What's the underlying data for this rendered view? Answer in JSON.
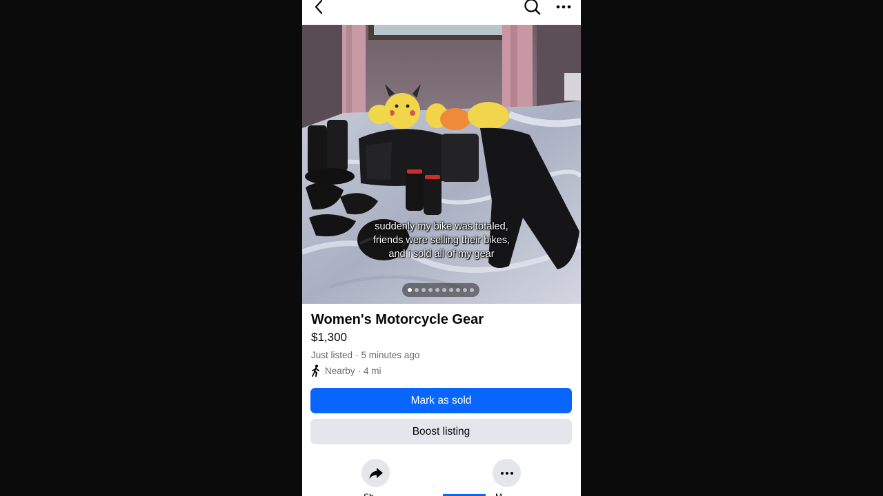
{
  "listing": {
    "title": "Women's Motorcycle Gear",
    "price": "$1,300",
    "listed": "Just listed",
    "time_ago": "5 minutes ago",
    "location": "Nearby",
    "distance": "4 mi"
  },
  "photo": {
    "caption": "suddenly my bike was totaled, friends were selling their bikes, and i sold all of my gear",
    "total_photos": 10,
    "current_photo": 1
  },
  "buttons": {
    "mark_sold": "Mark as sold",
    "boost": "Boost listing"
  },
  "actions": {
    "share_label": "Sh",
    "more_label": "M"
  },
  "icons": {
    "back": "back-chevron-icon",
    "search": "search-icon",
    "more": "more-horizontal-icon",
    "walk": "walking-person-icon",
    "share": "share-arrow-icon"
  },
  "colors": {
    "primary": "#0866ff",
    "secondary_bg": "#e4e6eb",
    "meta_text": "#65676b"
  }
}
